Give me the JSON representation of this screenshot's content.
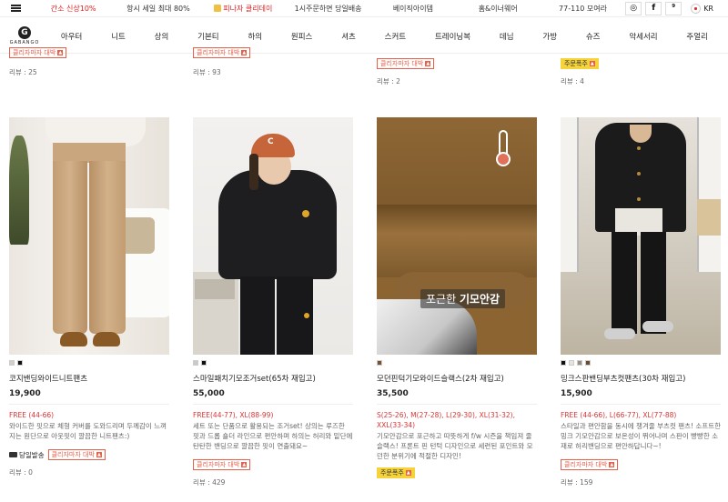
{
  "topbar": {
    "promos": [
      {
        "text": "간소 신상10%",
        "red": true
      },
      {
        "text": "항시 세일 최대 80%",
        "red": false
      },
      {
        "text": "피나자 클리데이",
        "red": true,
        "gift": true
      },
      {
        "text": "1시주문하면 당일배송",
        "red": false
      },
      {
        "text": "베이직아이템",
        "red": false
      },
      {
        "text": "홈&이너웨어",
        "red": false
      },
      {
        "text": "77-110 모여라",
        "red": false
      }
    ],
    "social": [
      "instagram-icon",
      "facebook-icon",
      "kakao-icon"
    ],
    "social_glyphs": [
      "◎",
      "f",
      "⁹"
    ],
    "language": "KR"
  },
  "nav": {
    "logo_mark": "G",
    "logo_text": "GABANGO",
    "categories": [
      "아우터",
      "니트",
      "상의",
      "기본티",
      "하의",
      "원피스",
      "셔츠",
      "스커트",
      "트레이닝복",
      "데님",
      "가방",
      "슈즈",
      "악세서리",
      "주얼리"
    ]
  },
  "top_row": [
    {
      "badge": "클리자마자 대박",
      "review": "리뷰 : 25"
    },
    {
      "badge": "클리자마자 대박",
      "review": "리뷰 : 93"
    },
    {
      "badge": "클리자마자 대박",
      "review": "리뷰 : 2"
    },
    {
      "badge": "주문폭주",
      "badge_style": "yellow",
      "review": "리뷰 : 4"
    }
  ],
  "products": [
    {
      "name": "코지밴딩와이드니트팬츠",
      "price": "19,900",
      "swatches": [
        "#d4cfc6",
        "#111111"
      ],
      "sizes_red": "FREE (44-66)",
      "sizes_blue": "",
      "description": "와이드한 핏으로 체형 커버를 도와드리며 두께감이 느껴지는 원단으로 아웃핏이 깔끔한 니트팬츠:)",
      "shipping": "당일발송",
      "badge": "클리자마자 대박",
      "review": "리뷰 : 0"
    },
    {
      "name": "스마일패치기모조거set(65차 재입고)",
      "price": "55,000",
      "swatches": [
        "#c9c9c9",
        "#111111"
      ],
      "sizes_red": "FREE(44-77), XL(88-99)",
      "sizes_blue": "",
      "description": "세트 또는 단품으로 활용되는 조거set! 상의는 루즈한 핏과 드롭 숄더 라인으로 편안하며 하의는 허리와 밑단에 탄탄한 밴딩으로 깔끔한 핏이 연출돼요~",
      "shipping": "",
      "badge": "클리자마자 대박",
      "review": "리뷰 : 429"
    },
    {
      "name": "모던핀턱기모와이드슬랙스(2차 재입고)",
      "price": "35,500",
      "swatches": [
        "#7a5230"
      ],
      "sizes_red": "S(25-26), M(27-28), L(29-30), XL(31-32), XXL(33-34)",
      "sizes_blue": "",
      "description": "기모안감으로 포근하고 따뜻하게 f/w 시즌을 책임져 줄 슬랙스! 프론트 핀 턴턱 디자인으로 세련된 포인트와 모던한 분위기에 적절한 디자인!",
      "shipping": "",
      "badge": "주문폭주",
      "badge_style": "yellow",
      "review": "",
      "overlay_plain": "포근한 ",
      "overlay_bold": "기모안감"
    },
    {
      "name": "밍크스판밴딩부츠컷팬츠(30차 재입고)",
      "price": "15,900",
      "swatches": [
        "#111111",
        "#e8e4dc",
        "#9a8f80",
        "#6b4a2e"
      ],
      "sizes_red": "FREE (44-66), L(66-77), XL(77-88)",
      "sizes_blue": "",
      "description": "스타일과 편안함을 동시에 챙겨줄 부츠컷 팬츠! 소프트한 밍크 기모안감으로 보온성이 뛰어나며 스판이 빵빵한 소재로 허리밴딩으로 편안하답니다~!",
      "shipping": "",
      "badge": "클리자마자 대박",
      "review": "리뷰 : 159"
    }
  ]
}
